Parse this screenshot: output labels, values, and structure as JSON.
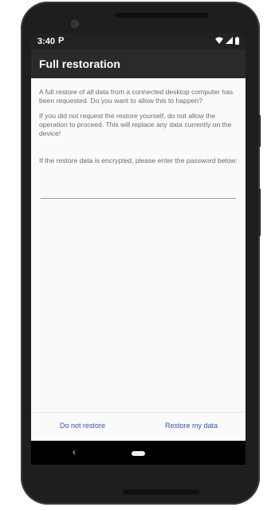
{
  "status_bar": {
    "time": "3:40",
    "notification_letter": "P",
    "icons": [
      "wifi-icon",
      "signal-icon",
      "battery-icon"
    ]
  },
  "app_bar": {
    "title": "Full restoration"
  },
  "content": {
    "paragraph_1": "A full restore of all data from a connected desktop computer has been requested. Do you want to allow this to happen?",
    "paragraph_2": "If you did not request the restore yourself, do not allow the operation to proceed. This will replace any data currently on the device!",
    "paragraph_3": "If the restore data is encrypted, please enter the password below:",
    "password_value": "",
    "password_placeholder": ""
  },
  "buttons": {
    "deny_label": "Do not restore",
    "allow_label": "Restore my data"
  },
  "nav_bar": {
    "back_icon": "back-icon",
    "home_icon": "home-pill-icon"
  },
  "colors": {
    "accent": "#2e57a6",
    "app_bar": "#2a2a2a",
    "status_bar": "#222222",
    "background": "#fafafa",
    "phone_body": "#1e1e1e"
  }
}
